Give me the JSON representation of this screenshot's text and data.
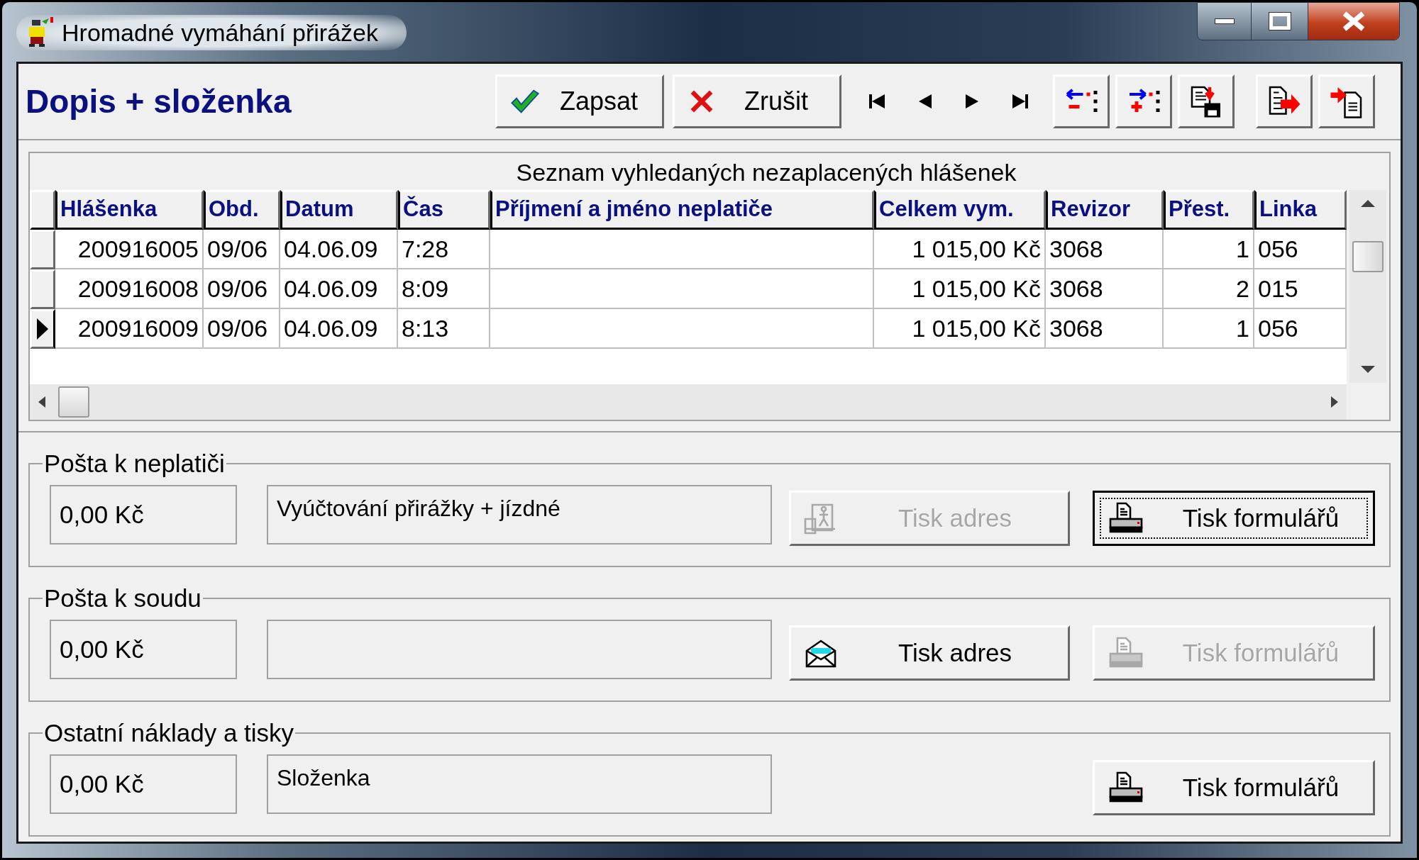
{
  "window": {
    "title": "Hromadné vymáhání přirážek"
  },
  "toolbar": {
    "heading": "Dopis + složenka",
    "buttons": [
      {
        "kind": "save",
        "label": "Zapsat"
      },
      {
        "kind": "cancel",
        "label": "Zrušit"
      }
    ]
  },
  "table": {
    "caption": "Seznam vyhledaných nezaplacených hlášenek",
    "columns": [
      "Hlášenka",
      "Obd.",
      "Datum",
      "Čas",
      "Příjmení a jméno neplatiče",
      "Celkem vym.",
      "Revizor",
      "Přest.",
      "Linka"
    ],
    "rows": [
      {
        "selected": false,
        "cells": [
          "200916005",
          "09/06",
          "04.06.09",
          "7:28",
          "",
          "1 015,00 Kč",
          "3068",
          "1",
          "056"
        ]
      },
      {
        "selected": false,
        "cells": [
          "200916008",
          "09/06",
          "04.06.09",
          "8:09",
          "",
          "1 015,00 Kč",
          "3068",
          "2",
          "015"
        ]
      },
      {
        "selected": true,
        "cells": [
          "200916009",
          "09/06",
          "04.06.09",
          "8:13",
          "",
          "1 015,00 Kč",
          "3068",
          "1",
          "056"
        ]
      }
    ]
  },
  "groups": [
    {
      "title": "Pošta k neplatiči",
      "amount": "0,00 Kč",
      "description": "Vyúčtování přirážky + jízdné",
      "buttons": [
        {
          "kind": "address",
          "label": "Tisk adres",
          "disabled": true,
          "focused": false
        },
        {
          "kind": "forms",
          "label": "Tisk formulářů",
          "disabled": false,
          "focused": true
        }
      ]
    },
    {
      "title": "Pošta k soudu",
      "amount": "0,00 Kč",
      "buttons": [
        {
          "kind": "address",
          "label": "Tisk adres",
          "disabled": false,
          "focused": false
        },
        {
          "kind": "forms",
          "label": "Tisk formulářů",
          "disabled": true,
          "focused": false
        }
      ]
    },
    {
      "title": "Ostatní náklady a tisky",
      "amount": "0,00 Kč",
      "description": "Složenka",
      "buttons": [
        {
          "kind": "forms",
          "label": "Tisk formulářů",
          "disabled": false,
          "focused": false
        }
      ]
    }
  ]
}
